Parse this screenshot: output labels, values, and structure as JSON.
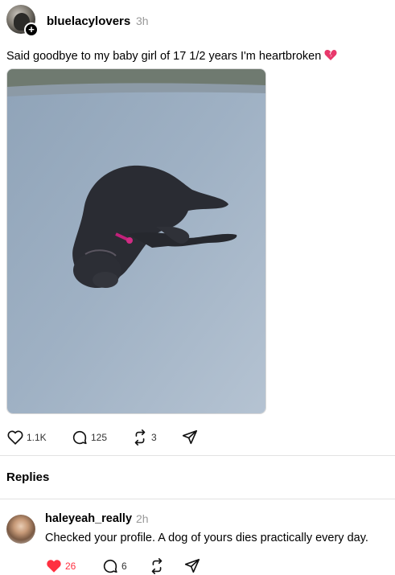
{
  "post": {
    "username": "bluelacylovers",
    "time": "3h",
    "text": "Said goodbye to my baby girl of 17 1/2 years I'm heartbroken",
    "emoji": "broken-heart-icon",
    "image_alt_subject": "dog-photo",
    "likes": "1.1K",
    "comments": "125",
    "reposts": "3"
  },
  "replies_section": {
    "label": "Replies"
  },
  "reply": {
    "username": "haleyeah_really",
    "time": "2h",
    "text": "Checked your profile. A dog of yours dies practically every day.",
    "likes": "26",
    "comments": "6",
    "liked_color": "#ff3040"
  }
}
